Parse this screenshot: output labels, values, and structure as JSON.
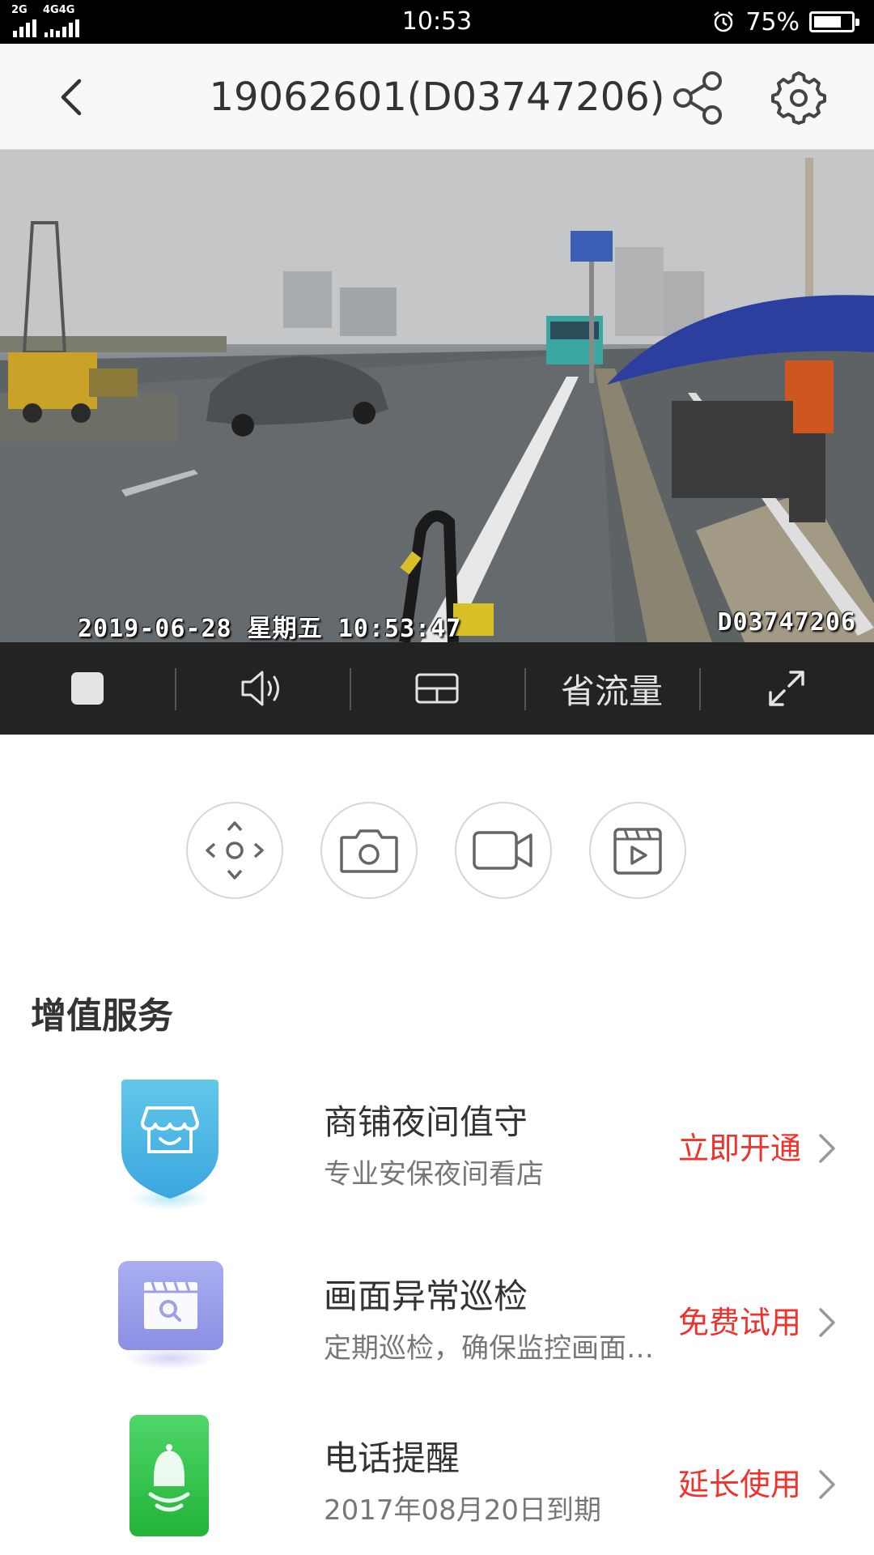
{
  "status_bar": {
    "network_1": "2G",
    "network_2": "4G",
    "network_3": "4G",
    "time": "10:53",
    "battery_percent": "75%",
    "battery_level": 0.75
  },
  "header": {
    "title": "19062601(D03747206)",
    "back_icon": "chevron-left-icon",
    "share_icon": "share-icon",
    "settings_icon": "gear-icon"
  },
  "video": {
    "timestamp": "2019-06-28 星期五 10:53:47",
    "device_id": "D03747206"
  },
  "controls": {
    "stop_icon": "stop-icon",
    "sound_icon": "speaker-icon",
    "quality_icon": "grid-icon",
    "save_flow_label": "省流量",
    "fullscreen_icon": "expand-icon"
  },
  "actions": [
    {
      "name": "ptz-control",
      "icon": "direction-pad-icon"
    },
    {
      "name": "snapshot",
      "icon": "camera-icon"
    },
    {
      "name": "record",
      "icon": "video-camera-icon"
    },
    {
      "name": "playback",
      "icon": "playback-icon"
    }
  ],
  "services": {
    "title": "增值服务",
    "items": [
      {
        "name": "商铺夜间值守",
        "desc": "专业安保夜间看店",
        "action": "立即开通",
        "icon": "shop-shield-icon"
      },
      {
        "name": "画面异常巡检",
        "desc": "定期巡检，确保监控画面正常",
        "action": "免费试用",
        "icon": "inspection-icon"
      },
      {
        "name": "电话提醒",
        "desc": "2017年08月20日到期",
        "action": "延长使用",
        "icon": "bell-icon"
      }
    ],
    "action_color": "#f0322b"
  }
}
